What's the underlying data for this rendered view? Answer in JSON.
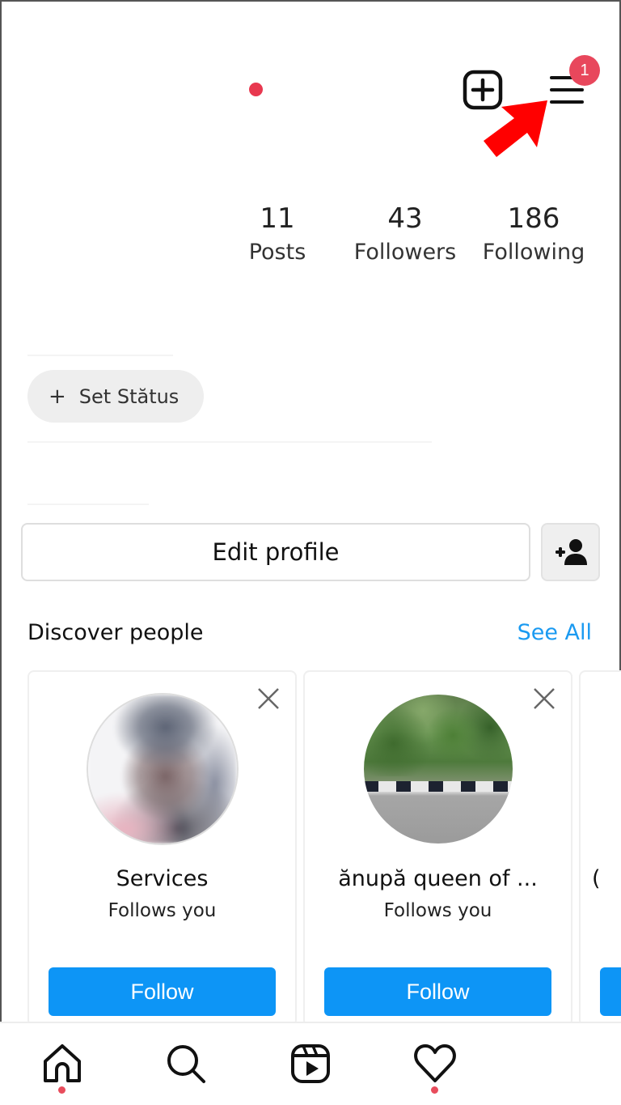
{
  "header": {
    "notification_badge": "1",
    "new_post_icon": "plus-square-icon",
    "menu_icon": "hamburger-menu-icon",
    "annotation": "red-arrow-pointing-to-menu"
  },
  "stats": [
    {
      "value": "11",
      "label": "Posts"
    },
    {
      "value": "43",
      "label": "Followers"
    },
    {
      "value": "186",
      "label": "Following"
    }
  ],
  "status_button": {
    "icon": "+",
    "label": "Set Stătus"
  },
  "actions": {
    "edit_profile": "Edit profile",
    "discover_people_icon": "add-person-icon"
  },
  "discover": {
    "title": "Discover people",
    "see_all": "See All",
    "cards": [
      {
        "name": "Services",
        "subtitle": "Follows you",
        "button": "Follow"
      },
      {
        "name": "ănupă queen of ...",
        "subtitle": "Follows you",
        "button": "Follow"
      },
      {
        "name": "",
        "subtitle": "",
        "button": ""
      }
    ]
  },
  "bottom_nav": [
    {
      "icon": "home-icon",
      "has_dot": true
    },
    {
      "icon": "search-icon",
      "has_dot": false
    },
    {
      "icon": "reels-icon",
      "has_dot": false
    },
    {
      "icon": "heart-icon",
      "has_dot": true
    }
  ],
  "colors": {
    "accent_blue": "#0d95f6",
    "link_blue": "#1a9af1",
    "notification_red": "#e8384f",
    "arrow_red": "#ff0000"
  }
}
